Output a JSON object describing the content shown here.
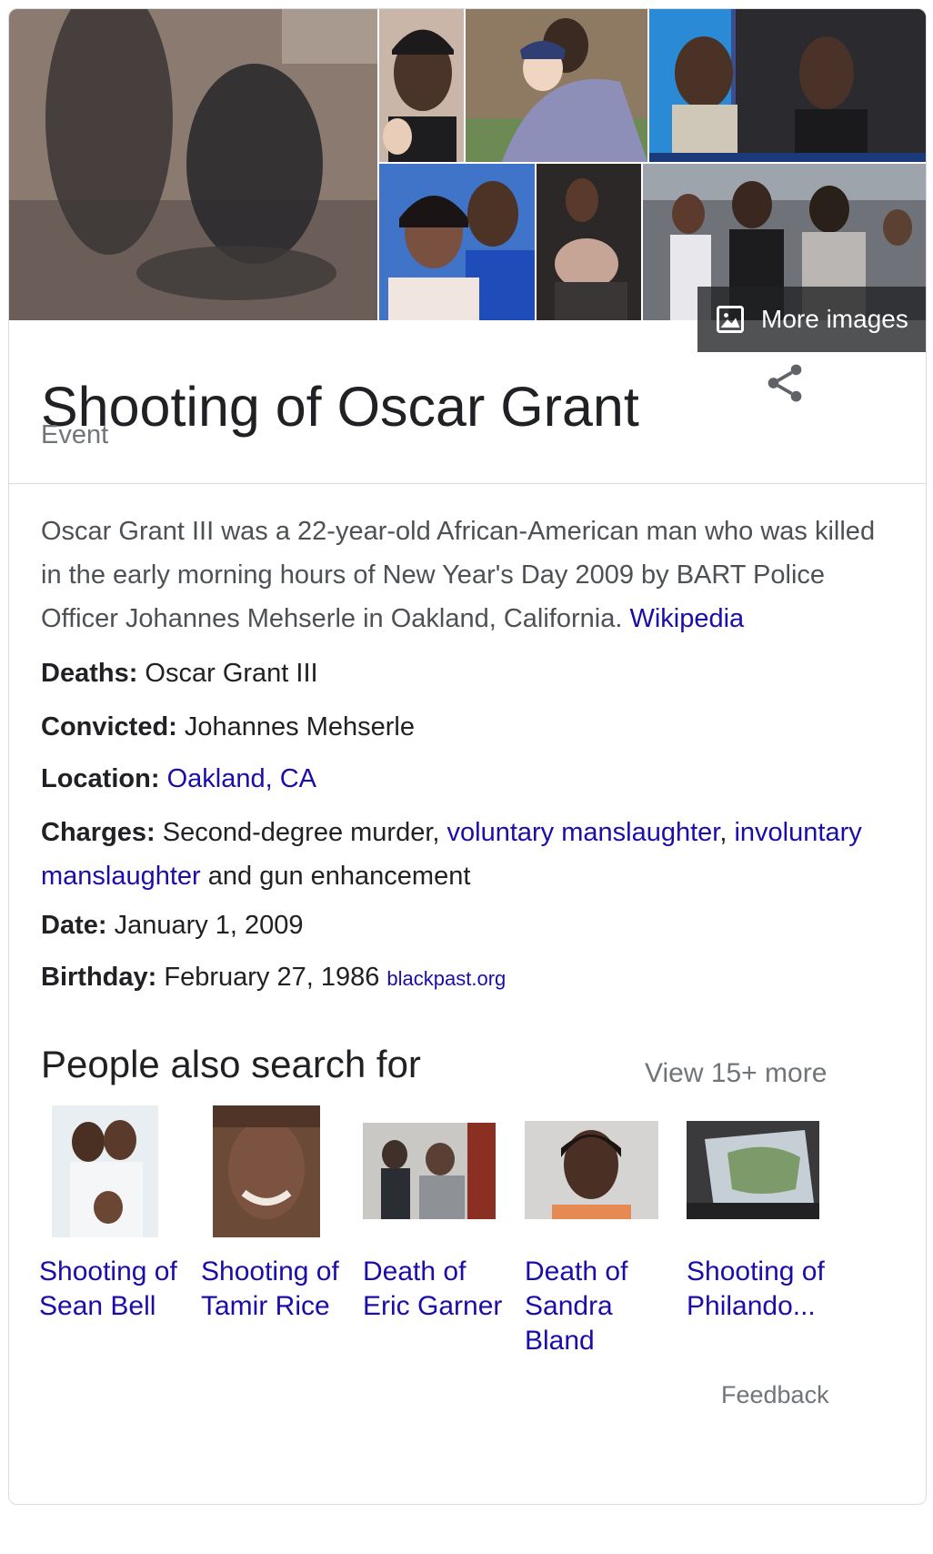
{
  "header": {
    "more_images_label": "More images",
    "title": "Shooting of Oscar Grant",
    "subtitle": "Event"
  },
  "description": {
    "text": "Oscar Grant III was a 22-year-old African-American man who was killed in the early morning hours of New Year's Day 2009 by BART Police Officer Johannes Mehserle in Oakland, California.",
    "source_link": "Wikipedia"
  },
  "facts": {
    "deaths": {
      "label": "Deaths:",
      "value": "Oscar Grant III"
    },
    "convicted": {
      "label": "Convicted:",
      "value": "Johannes Mehserle"
    },
    "location": {
      "label": "Location:",
      "link": "Oakland, CA"
    },
    "charges": {
      "label": "Charges:",
      "text_1": "Second-degree murder,",
      "link_1": "voluntary manslaughter",
      "comma": ",",
      "link_2": "involuntary manslaughter",
      "text_2": "and gun enhancement"
    },
    "date": {
      "label": "Date:",
      "value": "January 1, 2009"
    },
    "birthday": {
      "label": "Birthday:",
      "value": "February 27, 1986",
      "source": "blackpast.org"
    }
  },
  "people_also_search": {
    "title": "People also search for",
    "view_more": "View 15+ more",
    "items": [
      {
        "line1": "Shooting of",
        "line2": "Sean Bell",
        "line3": ""
      },
      {
        "line1": "Shooting of",
        "line2": "Tamir Rice",
        "line3": ""
      },
      {
        "line1": "Death of",
        "line2": "Eric Garner",
        "line3": ""
      },
      {
        "line1": "Death of",
        "line2": "Sandra",
        "line3": "Bland"
      },
      {
        "line1": "Shooting of",
        "line2": "Philando...",
        "line3": ""
      }
    ]
  },
  "footer": {
    "feedback": "Feedback"
  },
  "colors": {
    "link": "#1a0dab",
    "muted": "#70757a",
    "text": "#202124",
    "border": "#dadce0"
  },
  "icons": [
    "image-icon",
    "share-icon"
  ]
}
